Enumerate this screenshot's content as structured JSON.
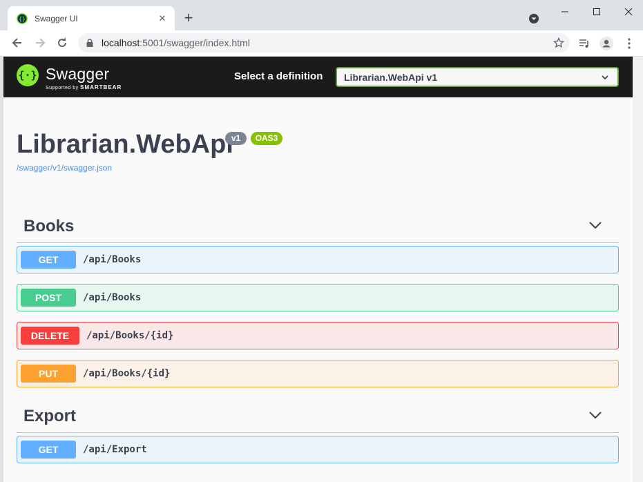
{
  "browser": {
    "tab_title": "Swagger UI",
    "tab_close": "✕",
    "new_tab": "+",
    "url_host": "localhost",
    "url_path": ":5001/swagger/index.html"
  },
  "swagger": {
    "brand": "Swagger",
    "brand_sub_prefix": "Supported by",
    "brand_sub_company": "SMARTBEAR",
    "definition_label": "Select a definition",
    "definition_value": "Librarian.WebApi v1",
    "api_title": "Librarian.WebApi",
    "version_badge": "v1",
    "oas_badge": "OAS3",
    "spec_link": "/swagger/v1/swagger.json"
  },
  "tags": [
    {
      "name": "Books",
      "operations": [
        {
          "method": "GET",
          "path": "/api/Books"
        },
        {
          "method": "POST",
          "path": "/api/Books"
        },
        {
          "method": "DELETE",
          "path": "/api/Books/{id}"
        },
        {
          "method": "PUT",
          "path": "/api/Books/{id}"
        }
      ]
    },
    {
      "name": "Export",
      "operations": [
        {
          "method": "GET",
          "path": "/api/Export"
        }
      ]
    }
  ],
  "colors": {
    "get": "#61affe",
    "post": "#49cc90",
    "delete": "#f93e3e",
    "put": "#fca130",
    "topbar": "#1b1b1b",
    "accent": "#62a03f",
    "oas": "#89bf04"
  }
}
